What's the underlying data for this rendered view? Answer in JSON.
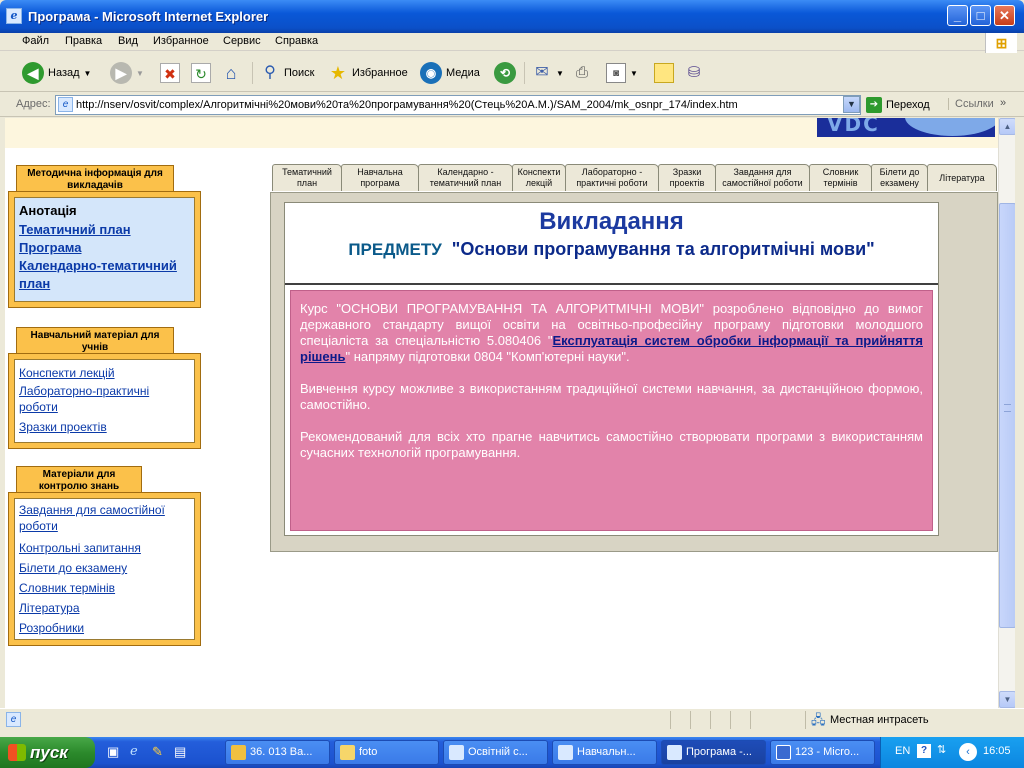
{
  "window": {
    "title": "Програма - Microsoft Internet Explorer",
    "min": "_",
    "max": "□",
    "close": "✕"
  },
  "menu": [
    "Файл",
    "Правка",
    "Вид",
    "Избранное",
    "Сервис",
    "Справка"
  ],
  "toolbar": {
    "back": "Назад",
    "search": "Поиск",
    "favorites": "Избранное",
    "media": "Медиа"
  },
  "address": {
    "label": "Адрес:",
    "url": "http://nserv/osvit/complex/Алгоритмічні%20мови%20та%20програмування%20(Стець%20А.М.)/SAM_2004/mk_osnpr_174/index.htm",
    "go": "Переход",
    "links": "Ссылки"
  },
  "banner": {
    "text": "VDC"
  },
  "sidebar": {
    "section1": {
      "title": "Методична інформація для викладачів",
      "current": "Анотація",
      "items": [
        "Тематичний план",
        "Програма",
        "Календарно-тематичний план"
      ]
    },
    "section2": {
      "title": "Навчальний матеріал для учнів",
      "items": [
        "Конспекти лекцій",
        "Лабораторно-практичні роботи",
        "Зразки проектів"
      ]
    },
    "section3": {
      "title": "Матеріали для контролю знань",
      "items": [
        "Завдання для самостійної роботи",
        "Контрольні запитання",
        "Білети до екзамену",
        "Словник термінів",
        "Література",
        "Розробники"
      ]
    }
  },
  "tabs": [
    "Тематичний план",
    "Навчальна програма",
    "Календарно - тематичний план",
    "Конспекти лекцій",
    "Лабораторно - практичні роботи",
    "Зразки проектів",
    "Завдання для самостійної роботи",
    "Словник термінів",
    "Білети до екзамену",
    "Література"
  ],
  "main": {
    "heading": "Викладання",
    "subheading_prefix": "ПРЕДМЕТУ",
    "subheading": "\"Основи програмування та алгоритмічні мови\"",
    "p1_before": "Курс \"ОСНОВИ ПРОГРАМУВАННЯ ТА АЛГОРИТМІЧНІ МОВИ\" розроблено відповідно до вимог державного стандарту вищої освіти на освітньо-професійну програму підготовки молодшого спеціаліста за спеціальністю 5.080406 \"",
    "p1_link": "Експлуатація систем обробки інформації та прийняття рішень",
    "p1_after": "\" напряму підготовки 0804 \"Комп'ютерні науки\".",
    "p2": "Вивчення курсу можливе з використанням традиційної системи навчання, за дистанційною формою, самостійно.",
    "p3": "Рекомендований для всіх хто прагне навчитись самостійно створювати програми з використанням сучасних технологій програмування."
  },
  "status": {
    "zone": "Местная интрасеть"
  },
  "taskbar": {
    "start": "пуск",
    "tasks": [
      "36. 013 Ва...",
      "foto",
      "Освітній с...",
      "Навчальн...",
      "Програма -...",
      "123 - Micro..."
    ],
    "lang": "EN",
    "time": "16:05"
  }
}
